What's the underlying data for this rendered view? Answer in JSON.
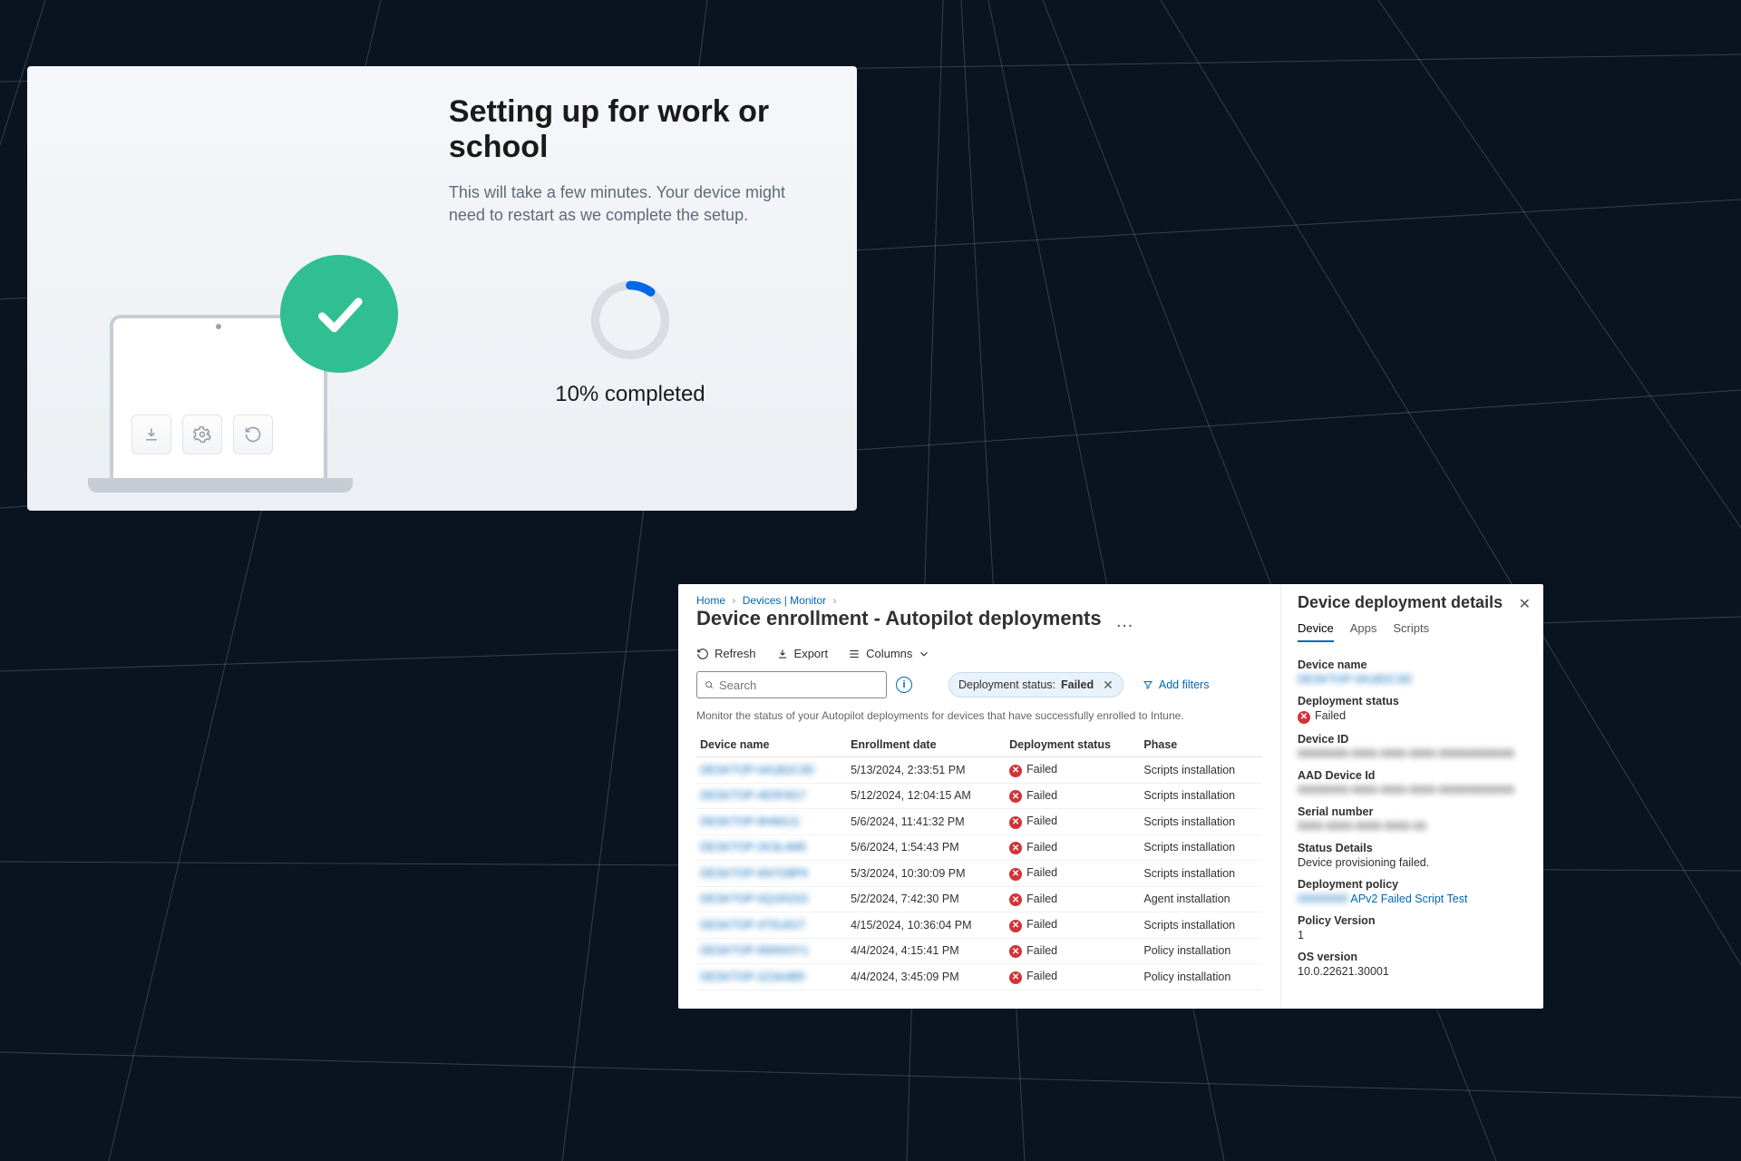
{
  "oobe": {
    "title": "Setting up for work or school",
    "subtitle": "This will take a few minutes. Your device might need to restart as we complete the setup.",
    "progress_percent": 10,
    "progress_label": "10% completed"
  },
  "intune": {
    "breadcrumb": [
      "Home",
      "Devices | Monitor"
    ],
    "title": "Device enrollment - Autopilot deployments",
    "toolbar": {
      "refresh": "Refresh",
      "export": "Export",
      "columns": "Columns"
    },
    "search_placeholder": "Search",
    "filter_chip_prefix": "Deployment status:",
    "filter_chip_value": "Failed",
    "add_filters": "Add filters",
    "note": "Monitor the status of your Autopilot deployments for devices that have successfully enrolled to Intune.",
    "columns": [
      "Device name",
      "Enrollment date",
      "Deployment status",
      "Phase"
    ],
    "status_failed": "Failed",
    "rows": [
      {
        "name": "DESKTOP-0A1B2C3D",
        "date": "5/13/2024, 2:33:51 PM",
        "phase": "Scripts installation"
      },
      {
        "name": "DESKTOP-4E5F6G7",
        "date": "5/12/2024, 12:04:15 AM",
        "phase": "Scripts installation"
      },
      {
        "name": "DESKTOP-8H9I0J1",
        "date": "5/6/2024, 11:41:32 PM",
        "phase": "Scripts installation"
      },
      {
        "name": "DESKTOP-2K3L4M5",
        "date": "5/6/2024, 1:54:43 PM",
        "phase": "Scripts installation"
      },
      {
        "name": "DESKTOP-6N7O8P9",
        "date": "5/3/2024, 10:30:09 PM",
        "phase": "Scripts installation"
      },
      {
        "name": "DESKTOP-0Q1R2S3",
        "date": "5/2/2024, 7:42:30 PM",
        "phase": "Agent installation"
      },
      {
        "name": "DESKTOP-4T5U6V7",
        "date": "4/15/2024, 10:36:04 PM",
        "phase": "Scripts installation"
      },
      {
        "name": "DESKTOP-8W9X0Y1",
        "date": "4/4/2024, 4:15:41 PM",
        "phase": "Policy installation"
      },
      {
        "name": "DESKTOP-2Z3A4B5",
        "date": "4/4/2024, 3:45:09 PM",
        "phase": "Policy installation"
      }
    ],
    "details": {
      "title": "Device deployment details",
      "tabs": [
        "Device",
        "Apps",
        "Scripts"
      ],
      "active_tab": 0,
      "device_name_label": "Device name",
      "device_name": "DESKTOP-0A1B2C3D",
      "deployment_status_label": "Deployment status",
      "deployment_status": "Failed",
      "device_id_label": "Device ID",
      "device_id": "00000000-0000-0000-0000-000000000000",
      "aad_id_label": "AAD Device Id",
      "aad_id": "00000000-0000-0000-0000-000000000000",
      "serial_label": "Serial number",
      "serial": "0000-0000-0000-0000-00",
      "status_details_label": "Status Details",
      "status_details": "Device provisioning failed.",
      "policy_label": "Deployment policy",
      "policy": "APv2 Failed Script Test",
      "policy_version_label": "Policy Version",
      "policy_version": "1",
      "os_label": "OS version",
      "os": "10.0.22621.30001"
    }
  }
}
